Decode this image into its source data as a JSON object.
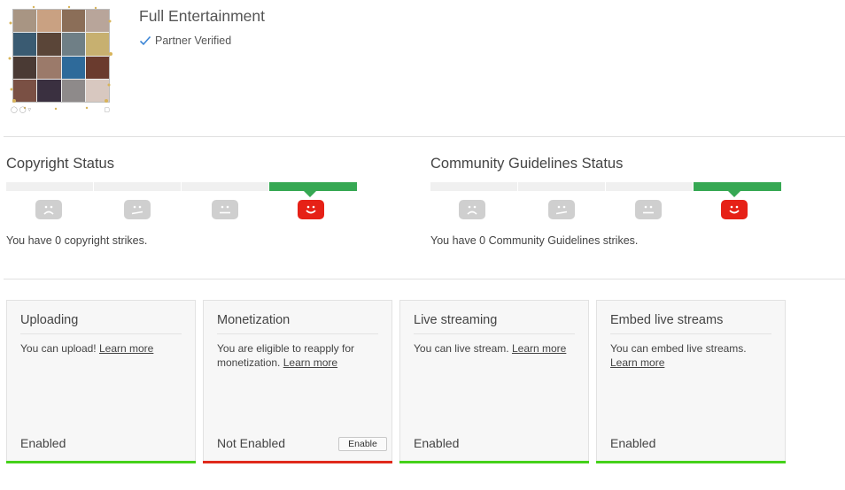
{
  "channel": {
    "title": "Full Entertainment",
    "badge": "Partner Verified",
    "badge_icon": "checkmark-icon"
  },
  "colors": {
    "accent_blue": "#3d86d6",
    "green_active": "#36a853",
    "red_face": "#e62117",
    "face_gray": "#cfcfcf",
    "bar_enabled": "#44d11a",
    "bar_disabled": "#e02a1c"
  },
  "copyright": {
    "title": "Copyright Status",
    "strikes": 0,
    "active_level": 4,
    "levels": [
      "sad-face-icon",
      "uneasy-face-icon",
      "neutral-face-icon",
      "happy-face-icon"
    ],
    "message": "You have 0 copyright strikes."
  },
  "community": {
    "title": "Community Guidelines Status",
    "strikes": 0,
    "active_level": 4,
    "levels": [
      "sad-face-icon",
      "uneasy-face-icon",
      "neutral-face-icon",
      "happy-face-icon"
    ],
    "message": "You have 0 Community Guidelines strikes."
  },
  "features": [
    {
      "title": "Uploading",
      "desc": "You can upload!",
      "link": "Learn more",
      "status": "Enabled",
      "enabled": true
    },
    {
      "title": "Monetization",
      "desc": "You are eligible to reapply for monetization.",
      "link": "Learn more",
      "status": "Not Enabled",
      "enabled": false,
      "action": "Enable"
    },
    {
      "title": "Live streaming",
      "desc": "You can live stream.",
      "link": "Learn more",
      "status": "Enabled",
      "enabled": true
    },
    {
      "title": "Embed live streams",
      "desc": "You can embed live streams.",
      "link": "Learn more",
      "status": "Enabled",
      "enabled": true
    }
  ]
}
